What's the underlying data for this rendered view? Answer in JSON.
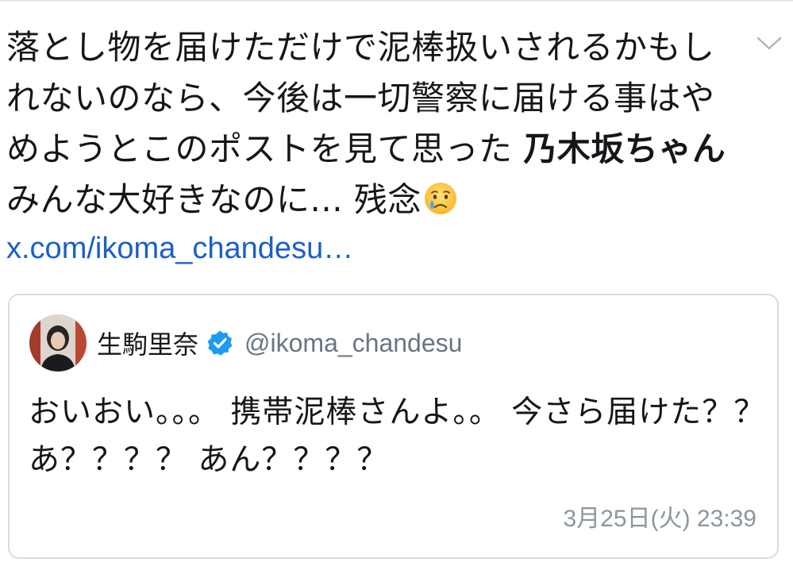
{
  "tweet": {
    "text_part1": "落とし物を届けただけで泥棒扱いされるかもしれないのなら、今後は一切警察に届ける事はやめようとこのポストを見て思った ",
    "text_bold": "乃木坂ちゃん",
    "text_part2": "みんな大好きなのに... 残念",
    "emoji": "crying-face",
    "link_text": "x.com/ikoma_chandesu…"
  },
  "quoted_tweet": {
    "display_name": "生駒里奈",
    "handle": "@ikoma_chandesu",
    "text": "おいおい。。。 携帯泥棒さんよ。。 今さら届けた？？ あ？？？？ あん？？？？",
    "timestamp": "3月25日(火) 23:39"
  },
  "icons": {
    "menu": "chevron-down-icon",
    "verified": "verified-badge-icon",
    "emoji": "crying-face-emoji-icon"
  },
  "colors": {
    "link": "#1a5fc9",
    "verified": "#1d9bf0",
    "secondary_text": "#657786",
    "border": "#d8dde2"
  }
}
